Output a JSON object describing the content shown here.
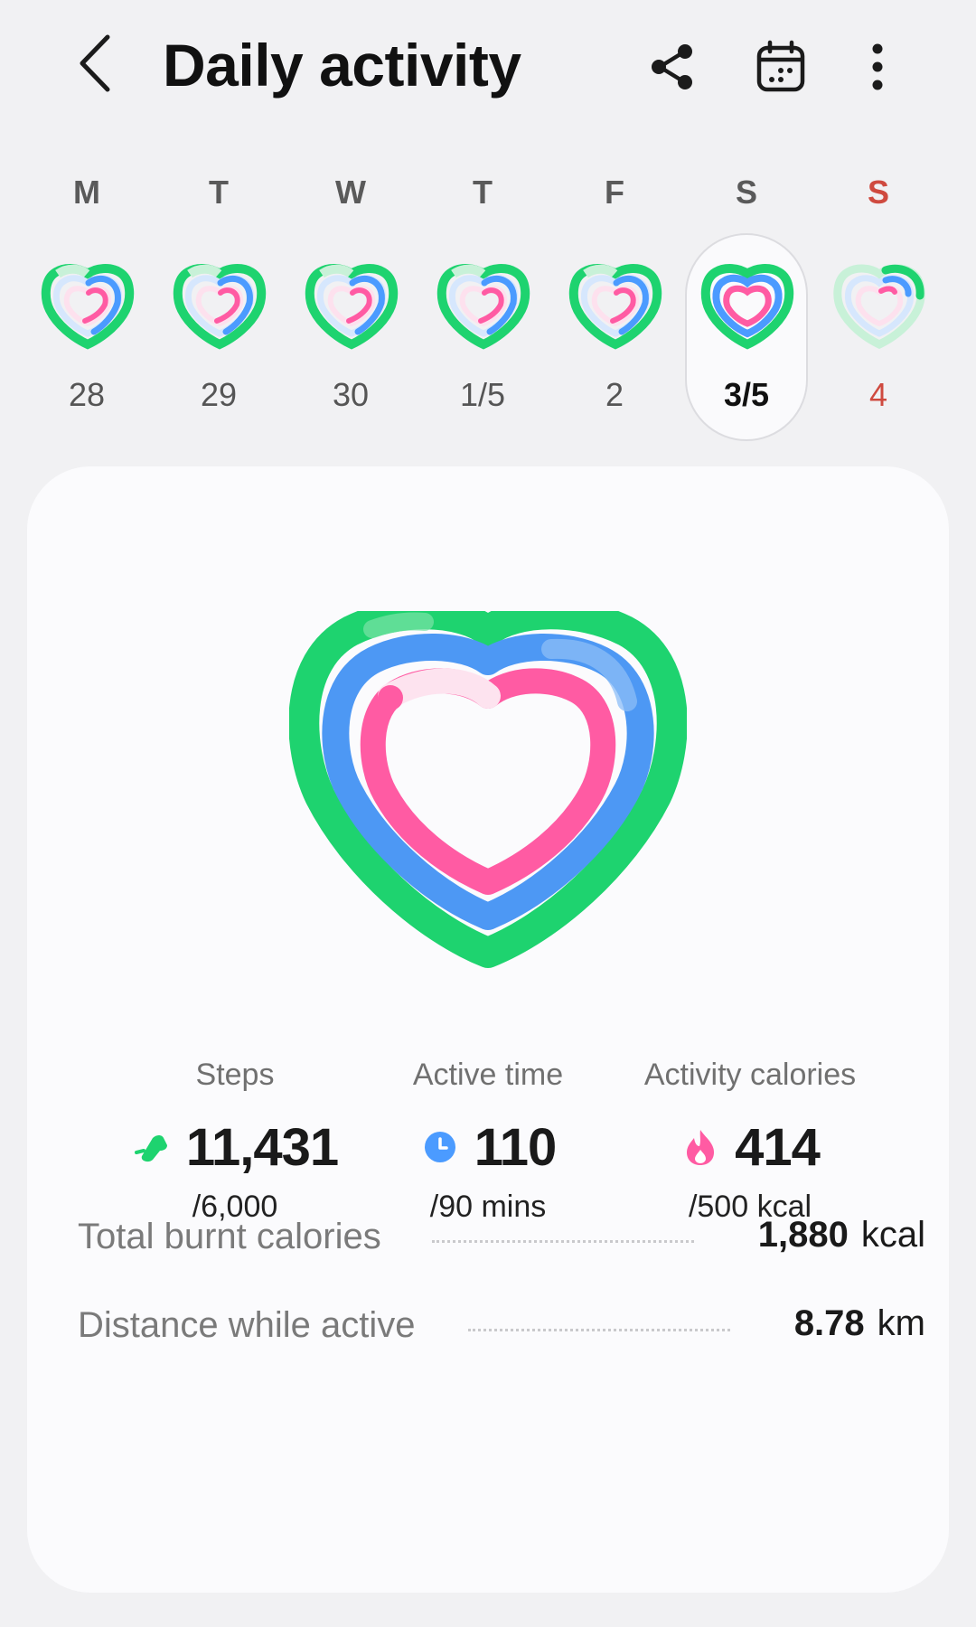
{
  "header": {
    "title": "Daily activity",
    "back_icon": "back-arrow-icon",
    "share_icon": "share-icon",
    "calendar_icon": "calendar-icon",
    "more_icon": "more-vertical-icon"
  },
  "week": [
    {
      "letter": "M",
      "number": "28"
    },
    {
      "letter": "T",
      "number": "29"
    },
    {
      "letter": "W",
      "number": "30"
    },
    {
      "letter": "T",
      "number": "1/5"
    },
    {
      "letter": "F",
      "number": "2"
    },
    {
      "letter": "S",
      "number": "3/5",
      "selected": true
    },
    {
      "letter": "S",
      "number": "4",
      "sunday": true
    }
  ],
  "stats": {
    "steps": {
      "label": "Steps",
      "value": "11,431",
      "goal": "/6,000",
      "icon": "shoe-icon"
    },
    "active_time": {
      "label": "Active time",
      "value": "110",
      "goal": "/90 mins",
      "icon": "clock-icon"
    },
    "calories": {
      "label": "Activity calories",
      "value": "414",
      "goal": "/500 kcal",
      "icon": "flame-icon"
    }
  },
  "summary": {
    "total_burnt": {
      "label": "Total burnt calories",
      "value": "1,880",
      "unit": "kcal"
    },
    "distance": {
      "label": "Distance while active",
      "value": "8.78",
      "unit": "km"
    }
  },
  "colors": {
    "steps_green": "#1ed36f",
    "active_blue": "#4b9bff",
    "calories_pink": "#ff5ba3",
    "sunday_red": "#cf4a3f"
  }
}
